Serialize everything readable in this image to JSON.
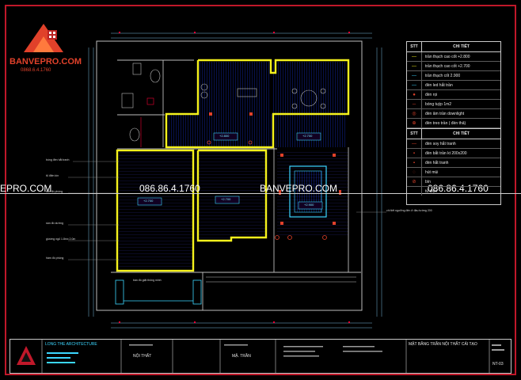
{
  "brand": {
    "name": "BANVEPRO.COM",
    "phone": "0868.6.4.1760"
  },
  "watermark": {
    "left": "EPRO.COM",
    "phone1": "086.86.4.1760",
    "center": "BANVEPRO.COM",
    "phone2": "086.86.4.1760"
  },
  "legend": {
    "col_stt": "STT",
    "col_detail": "CHI TIẾT",
    "col_stt2": "STT",
    "col_detail2": "CHI TIẾT",
    "rows_a": [
      {
        "symbol": "—",
        "label": "trần thạch cao cốt +2.800"
      },
      {
        "symbol": "—",
        "label": "trần thạch cao cốt +2.700"
      },
      {
        "symbol": "—",
        "label": "trần thạch cốt 2.900"
      },
      {
        "symbol": "—",
        "label": "đèn led hắt trần"
      },
      {
        "symbol": "●",
        "label": "đèn rọi"
      },
      {
        "symbol": "─",
        "label": "bóng tuýp 1m2"
      },
      {
        "symbol": "◎",
        "label": "đèn âm trần downlight"
      },
      {
        "symbol": "⊕",
        "label": "đèn treo trần ( đèn thả)"
      }
    ],
    "rows_b": [
      {
        "symbol": "—",
        "label": "đèn soy hắt tranh"
      },
      {
        "symbol": "▪",
        "label": "đèn bắt trần kt 200x200"
      },
      {
        "symbol": "▪",
        "label": "đèn hắt tranh"
      },
      {
        "symbol": "◌",
        "label": "hút mùi"
      },
      {
        "symbol": "⊘",
        "label": "bìn"
      },
      {
        "symbol": "",
        "label": "tủ điện"
      }
    ]
  },
  "plan_labels": {
    "level1": "+2.800",
    "level2": "+2.700",
    "level3": "+2.700",
    "level4": "+2.700",
    "level5": "+2.900"
  },
  "notes_left": [
    "bóng đèn hắt tranh",
    "tủ điện kín",
    "sàn đồ phòng",
    "sàn đồ dường",
    "giường ngủ 1.8mx 2.0m",
    "hầm đồ phòng",
    "bàn đồ giặt thông minh"
  ],
  "note_right": "chi tiết ngưỡng đèn ở đầu tường 200",
  "titleblock": {
    "company": "LONG THE ARCHITECTURE",
    "field1": "NỘI THẤT",
    "field2": "MẶ. TRẦN",
    "drawing_title": "MẶT BẰNG TRẦN NỘI THẤT CẢI TẠO",
    "sheet": "NT-03"
  },
  "colors": {
    "frame": "#c0182a",
    "accent_yellow": "#f5f21c",
    "plan_line": "#bdbdbd",
    "hatch": "#1c3cff",
    "brand": "#e0412a"
  }
}
